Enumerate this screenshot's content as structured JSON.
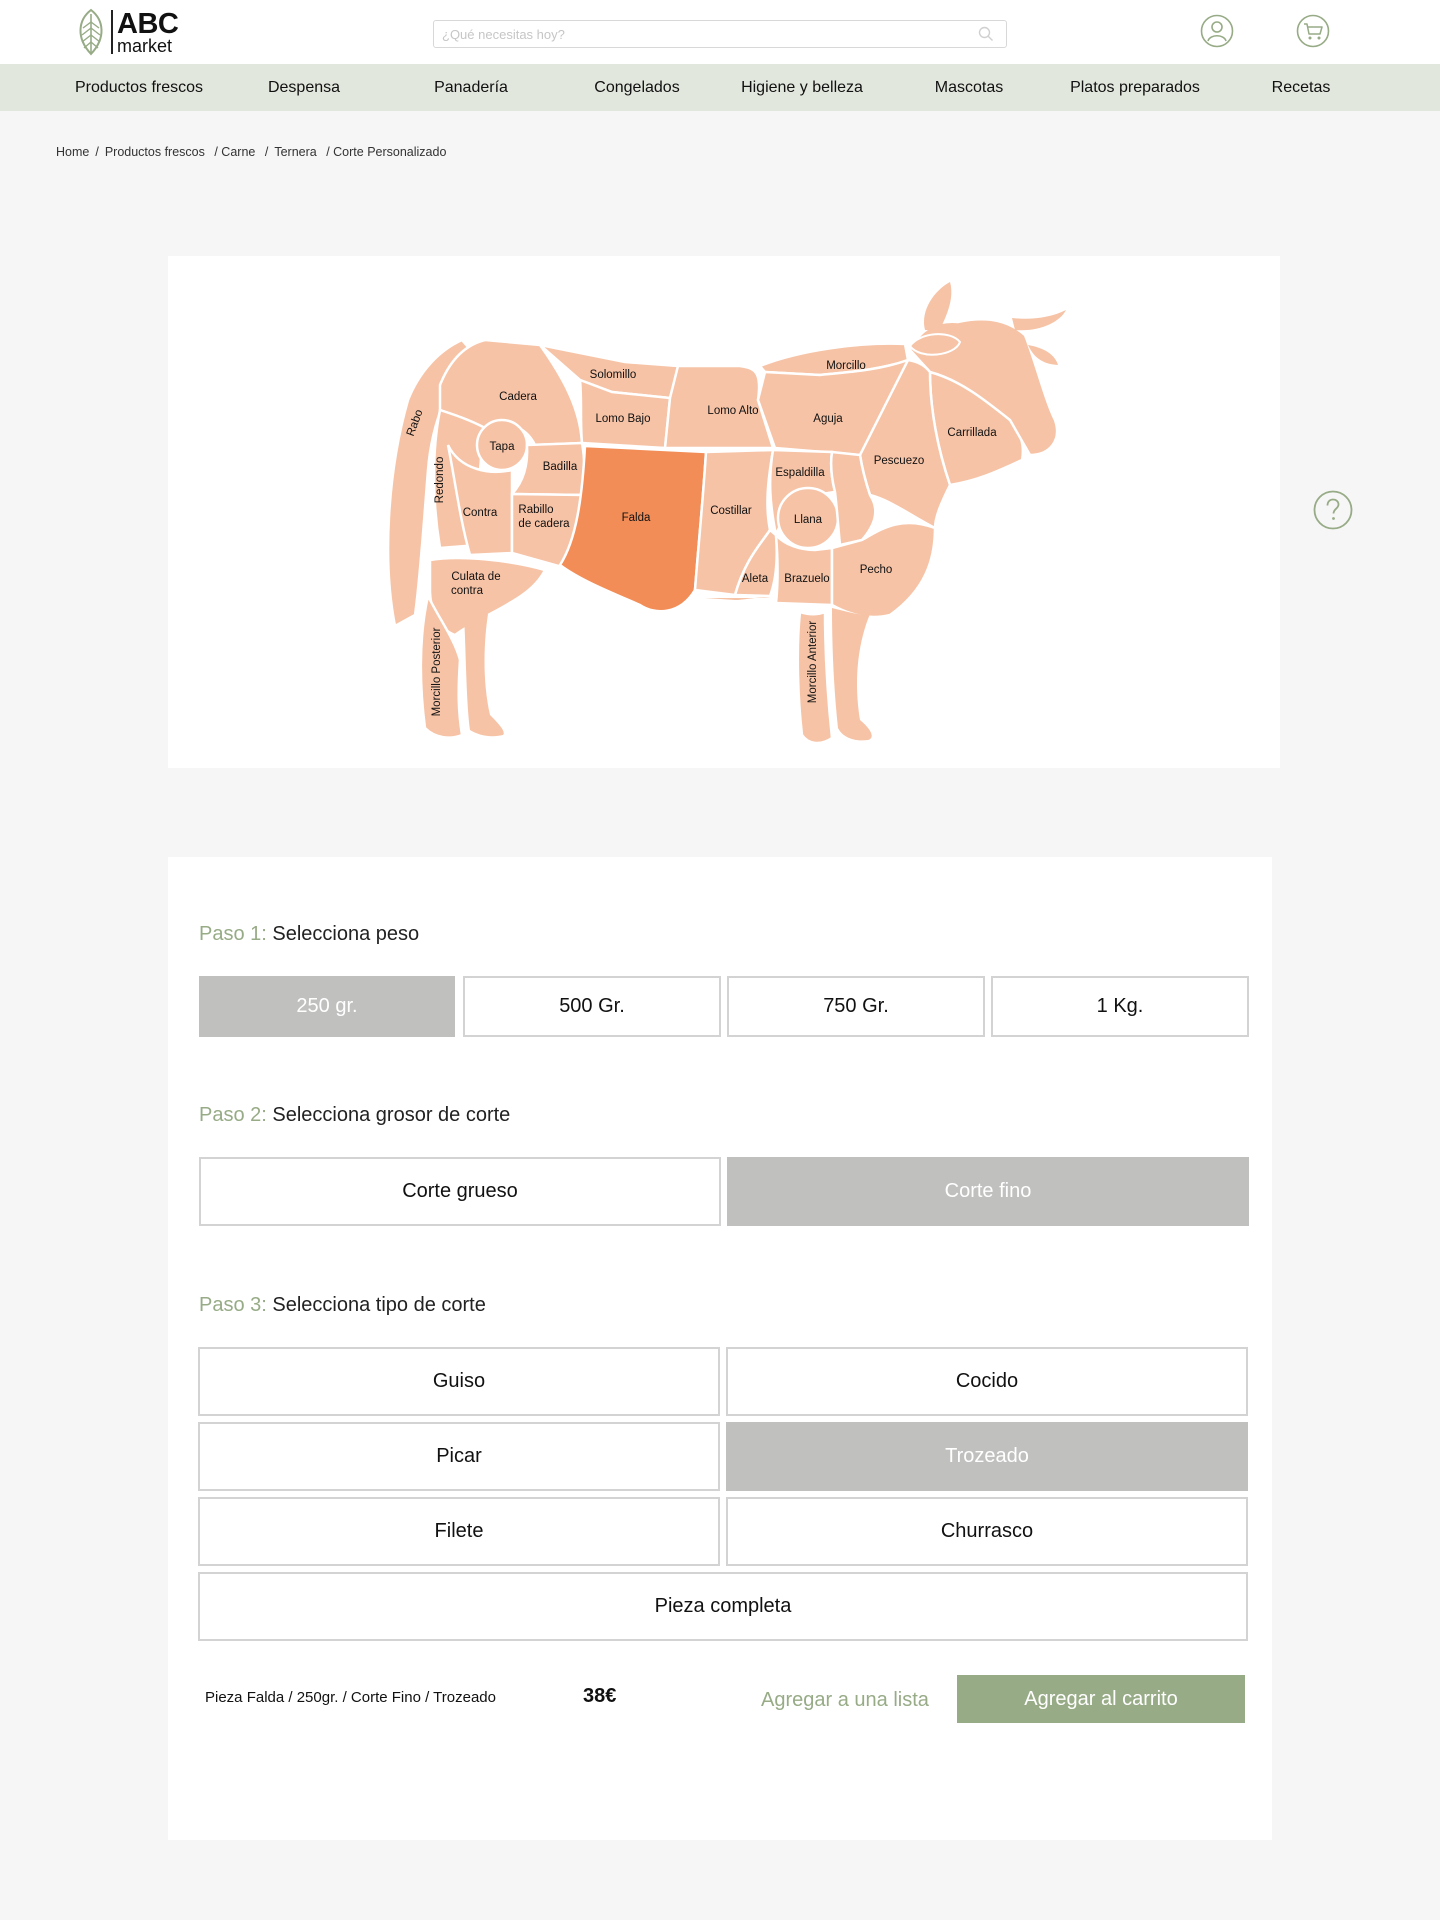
{
  "brand": {
    "name_top": "ABC",
    "name_bottom": "market",
    "accent_color": "#97ab86"
  },
  "search": {
    "placeholder": "¿Qué necesitas hoy?",
    "value": ""
  },
  "header_icons": [
    "user-icon",
    "cart-icon"
  ],
  "nav": {
    "items": [
      "Productos frescos",
      "Despensa",
      "Panadería",
      "Congelados",
      "Higiene y belleza",
      "Mascotas",
      "Platos preparados",
      "Recetas"
    ]
  },
  "breadcrumb": [
    "Home",
    "Productos frescos",
    "/ Carne",
    "Ternera",
    "/ Corte Personalizado"
  ],
  "diagram": {
    "selected_cut": "Falda",
    "cuts": {
      "rabo": "Rabo",
      "cadera": "Cadera",
      "solomillo": "Solomillo",
      "lomo_bajo": "Lomo Bajo",
      "lomo_alto": "Lomo Alto",
      "morcillo": "Morcillo",
      "aguja": "Aguja",
      "carrillada": "Carrillada",
      "tapa": "Tapa",
      "badilla": "Badilla",
      "redondo": "Redondo",
      "contra": "Contra",
      "rabillo_1": "Rabillo",
      "rabillo_2": "de cadera",
      "falda": "Falda",
      "costillar": "Costillar",
      "espaldilla": "Espaldilla",
      "llana": "Llana",
      "pescuezo": "Pescuezo",
      "culata_1": "Culata de",
      "culata_2": "contra",
      "aleta": "Aleta",
      "brazuelo": "Brazuelo",
      "pecho": "Pecho",
      "morcillo_posterior": "Morcillo Posterior",
      "morcillo_anterior": "Morcillo Anterior"
    },
    "colors": {
      "cut": "#f6c3a6",
      "selected": "#f28d57"
    }
  },
  "steps": [
    {
      "num": "Paso 1:",
      "title": "Selecciona peso",
      "options": [
        "250 gr.",
        "500 Gr.",
        "750 Gr.",
        "1 Kg."
      ],
      "selected": "250 gr."
    },
    {
      "num": "Paso 2:",
      "title": "Selecciona grosor de corte",
      "options": [
        "Corte grueso",
        "Corte fino"
      ],
      "selected": "Corte fino"
    },
    {
      "num": "Paso 3:",
      "title": "Selecciona tipo de corte",
      "options": [
        "Guiso",
        "Cocido",
        "Picar",
        "Trozeado",
        "Filete",
        "Churrasco",
        "Pieza completa"
      ],
      "selected": "Trozeado"
    }
  ],
  "summary": {
    "text": "Pieza Falda / 250gr. / Corte Fino / Trozeado",
    "price": "38€",
    "add_to_list": "Agregar a una lista",
    "add_to_cart": "Agregar al carrito"
  }
}
